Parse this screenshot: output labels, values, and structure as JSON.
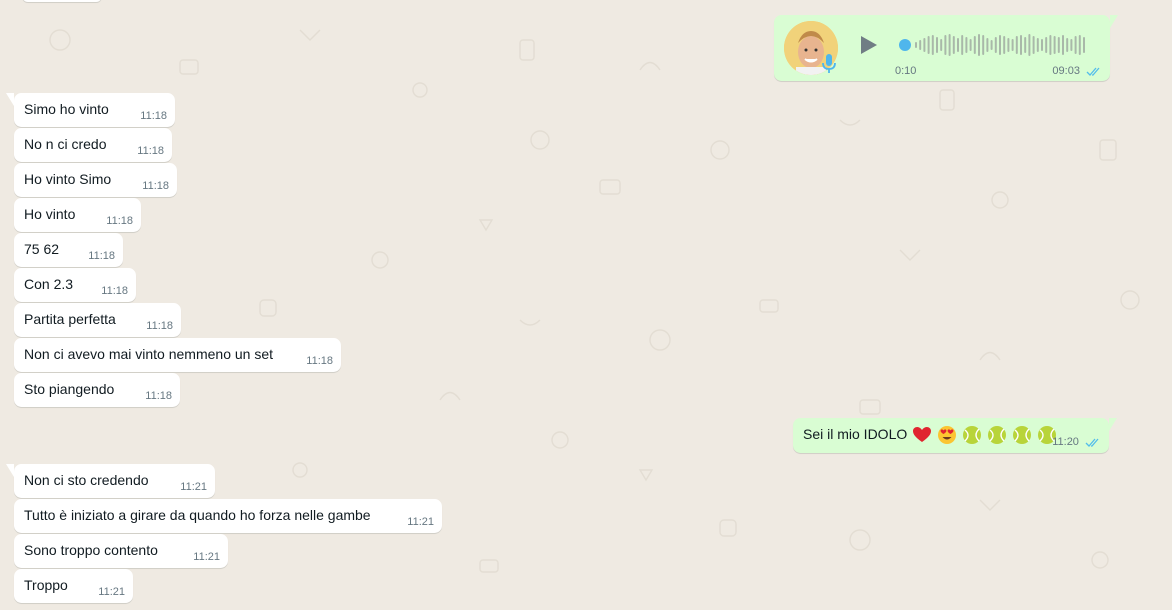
{
  "colors": {
    "background": "#efeae2",
    "incoming_bubble": "#ffffff",
    "outgoing_bubble": "#d9fdd3",
    "timestamp": "#667781",
    "read_ticks": "#53bdeb"
  },
  "voice_message": {
    "duration": "0:10",
    "time": "09:03",
    "status_icon": "double-check-read-icon"
  },
  "incoming_group_1": [
    {
      "text": "Simo ho vinto",
      "time": "11:18"
    },
    {
      "text": "No n ci credo",
      "time": "11:18"
    },
    {
      "text": "Ho vinto Simo",
      "time": "11:18"
    },
    {
      "text": "Ho vinto",
      "time": "11:18"
    },
    {
      "text": "75 62",
      "time": "11:18"
    },
    {
      "text": "Con 2.3",
      "time": "11:18"
    },
    {
      "text": "Partita perfetta",
      "time": "11:18"
    },
    {
      "text": "Non ci avevo mai vinto nemmeno un set",
      "time": "11:18"
    },
    {
      "text": "Sto piangendo",
      "time": "11:18"
    }
  ],
  "outgoing_text": {
    "text": "Sei il mio IDOLO",
    "emojis": [
      "red-heart-emoji",
      "heart-eyes-emoji",
      "tennis-ball-emoji",
      "tennis-ball-emoji",
      "tennis-ball-emoji",
      "tennis-ball-emoji"
    ],
    "time": "11:20",
    "status_icon": "double-check-read-icon"
  },
  "incoming_group_2": [
    {
      "text": "Non ci sto credendo",
      "time": "11:21"
    },
    {
      "text": "Tutto è iniziato a girare da quando ho forza nelle gambe",
      "time": "11:21"
    },
    {
      "text": "Sono troppo contento",
      "time": "11:21"
    },
    {
      "text": "Troppo",
      "time": "11:21"
    }
  ]
}
